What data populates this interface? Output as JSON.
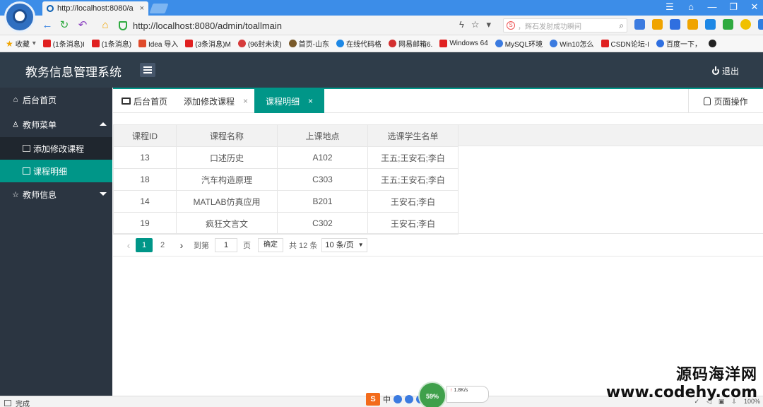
{
  "browser": {
    "tab_title": "http://localhost:8080/a",
    "tab_close": "×",
    "url": "http://localhost:8080/admin/toallmain",
    "search_placeholder": "，辉石发射成功瞬间",
    "win_controls": [
      "☰",
      "⌂",
      "—",
      "❐",
      "✕"
    ],
    "bookmarks": [
      {
        "label": "收藏",
        "color": "#f0a400"
      },
      {
        "label": "(1条消息)I",
        "color": "#e02020"
      },
      {
        "label": "(1条消息)",
        "color": "#e02020"
      },
      {
        "label": "Idea 导入",
        "color": "#e04a2a"
      },
      {
        "label": "(3条消息)M",
        "color": "#e02020"
      },
      {
        "label": "(96封未读)",
        "color": "#d63b3b"
      },
      {
        "label": "首页-山东",
        "color": "#7a5a2a"
      },
      {
        "label": "在线代码格",
        "color": "#1e88e5"
      },
      {
        "label": "网易邮箱6.",
        "color": "#d32f2f"
      },
      {
        "label": "Windows 64",
        "color": "#e02020"
      },
      {
        "label": "MySQL环境",
        "color": "#3b7be0"
      },
      {
        "label": "Win10怎么",
        "color": "#3b7be0"
      },
      {
        "label": "CSDN论坛-I",
        "color": "#e02020"
      },
      {
        "label": "百度一下，",
        "color": "#2f6fe0"
      },
      {
        "label": "",
        "color": "#222222"
      }
    ]
  },
  "app": {
    "title": "教务信息管理系统",
    "logout": "退出"
  },
  "sidebar": {
    "home": "后台首页",
    "teacher_menu": "教师菜单",
    "sub_items": [
      "添加修改课程",
      "课程明细"
    ],
    "teacher_info": "教师信息"
  },
  "tabs": {
    "home": "后台首页",
    "add_course": "添加修改课程",
    "course_detail": "课程明细",
    "close": "×",
    "page_op": "页面操作"
  },
  "table": {
    "headers": [
      "课程ID",
      "课程名称",
      "上课地点",
      "选课学生名单"
    ],
    "rows": [
      [
        "13",
        "口述历史",
        "A102",
        "王五;王安石;李白"
      ],
      [
        "18",
        "汽车构造原理",
        "C303",
        "王五;王安石;李白"
      ],
      [
        "14",
        "MATLAB仿真应用",
        "B201",
        "王安石;李白"
      ],
      [
        "19",
        "疯狂文言文",
        "C302",
        "王安石;李白"
      ]
    ]
  },
  "pager": {
    "prev": "‹",
    "pages": [
      "1",
      "2"
    ],
    "next": "›",
    "goto_label": "到第",
    "goto_value": "1",
    "page_unit": "页",
    "confirm": "确定",
    "total": "共 12 条",
    "page_size": "10 条/页"
  },
  "status": {
    "text": "完成",
    "ime_label": "中",
    "speed_percent": "59%",
    "speed_rate": "1.8K/s",
    "zoom": "100%"
  },
  "watermark": {
    "cn": "源码海洋网",
    "en": "www.codehy.com"
  }
}
